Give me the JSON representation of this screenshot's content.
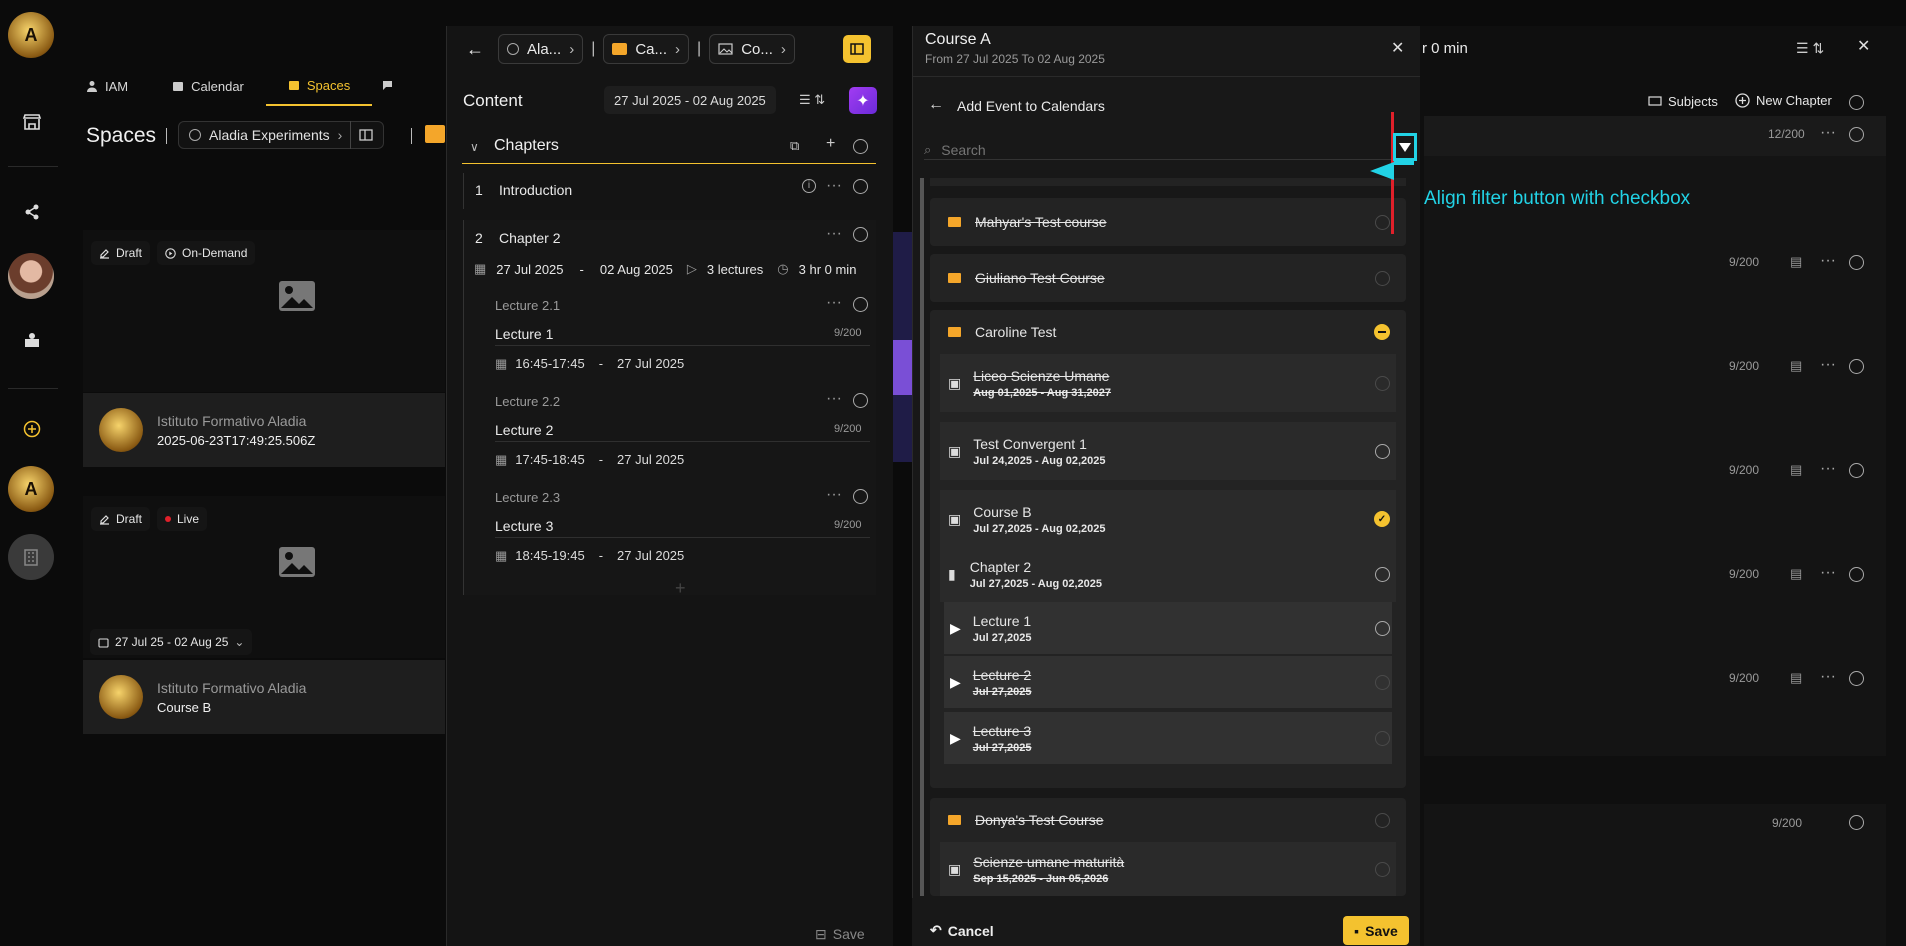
{
  "nav": {
    "tabs": [
      {
        "label": "IAM"
      },
      {
        "label": "Calendar"
      },
      {
        "label": "Spaces"
      }
    ]
  },
  "spaces": {
    "title": "Spaces",
    "breadcrumb": "Aladia Experiments",
    "cards": [
      {
        "tag1": "Draft",
        "tag2": "On-Demand",
        "institute": "Istituto Formativo Aladia",
        "sub": "2025-06-23T17:49:25.506Z"
      },
      {
        "tag1": "Draft",
        "tag2": "Live",
        "date_range": "27 Jul 25 - 02 Aug 25",
        "institute": "Istituto Formativo Aladia",
        "sub": "Course B"
      }
    ]
  },
  "content_panel": {
    "crumbs": [
      "Ala...",
      "Ca...",
      "Co..."
    ],
    "title": "Content",
    "date_range": "27 Jul 2025 - 02 Aug 2025",
    "chapters_label": "Chapters",
    "chapters": [
      {
        "num": "1",
        "name": "Introduction"
      },
      {
        "num": "2",
        "name": "Chapter 2",
        "start": "27 Jul 2025",
        "end": "02 Aug 2025",
        "lectures": "3 lectures",
        "duration": "3 hr 0 min"
      }
    ],
    "lectures": [
      {
        "code": "Lecture 2.1",
        "name": "Lecture 1",
        "count": "9/200",
        "time": "16:45-17:45",
        "date": "27 Jul 2025"
      },
      {
        "code": "Lecture 2.2",
        "name": "Lecture 2",
        "count": "9/200",
        "time": "17:45-18:45",
        "date": "27 Jul 2025"
      },
      {
        "code": "Lecture 2.3",
        "name": "Lecture 3",
        "count": "9/200",
        "time": "18:45-19:45",
        "date": "27 Jul 2025"
      }
    ],
    "save": "Save"
  },
  "modal": {
    "title": "Course A",
    "subtitle": "From 27 Jul 2025 To 02 Aug 2025",
    "back_label": "Add Event to Calendars",
    "search_placeholder": "Search",
    "annotation": "Align filter button with checkbox",
    "items": {
      "mahyar": "Mahyar's Test course",
      "giuliano": "Giuliano Test Course",
      "caroline": "Caroline Test",
      "liceo": {
        "name": "Liceo Scienze Umane",
        "date": "Aug 01,2025 - Aug 31,2027"
      },
      "convergent": {
        "name": "Test Convergent 1",
        "date": "Jul 24,2025 - Aug 02,2025"
      },
      "courseb": {
        "name": "Course B",
        "date": "Jul 27,2025 - Aug 02,2025"
      },
      "chapter2": {
        "name": "Chapter 2",
        "date": "Jul 27,2025 - Aug 02,2025"
      },
      "lec1": {
        "name": "Lecture 1",
        "date": "Jul 27,2025"
      },
      "lec2": {
        "name": "Lecture 2",
        "date": "Jul 27,2025"
      },
      "lec3": {
        "name": "Lecture 3",
        "date": "Jul 27,2025"
      },
      "donya": "Donya's Test Course",
      "scienze": {
        "name": "Scienze umane maturità",
        "date": "Sep 15,2025 - Jun 05,2026"
      }
    },
    "cancel": "Cancel",
    "save": "Save"
  },
  "background": {
    "header_text": "r 0 min",
    "subjects": "Subjects",
    "new_chapter": "New Chapter",
    "counts": [
      "12/200",
      "9/200",
      "9/200",
      "9/200",
      "9/200",
      "9/200",
      "9/200"
    ]
  },
  "colors": {
    "accent": "#f4c22f",
    "annotation": "#22d3e6",
    "marker": "#e0202a"
  }
}
